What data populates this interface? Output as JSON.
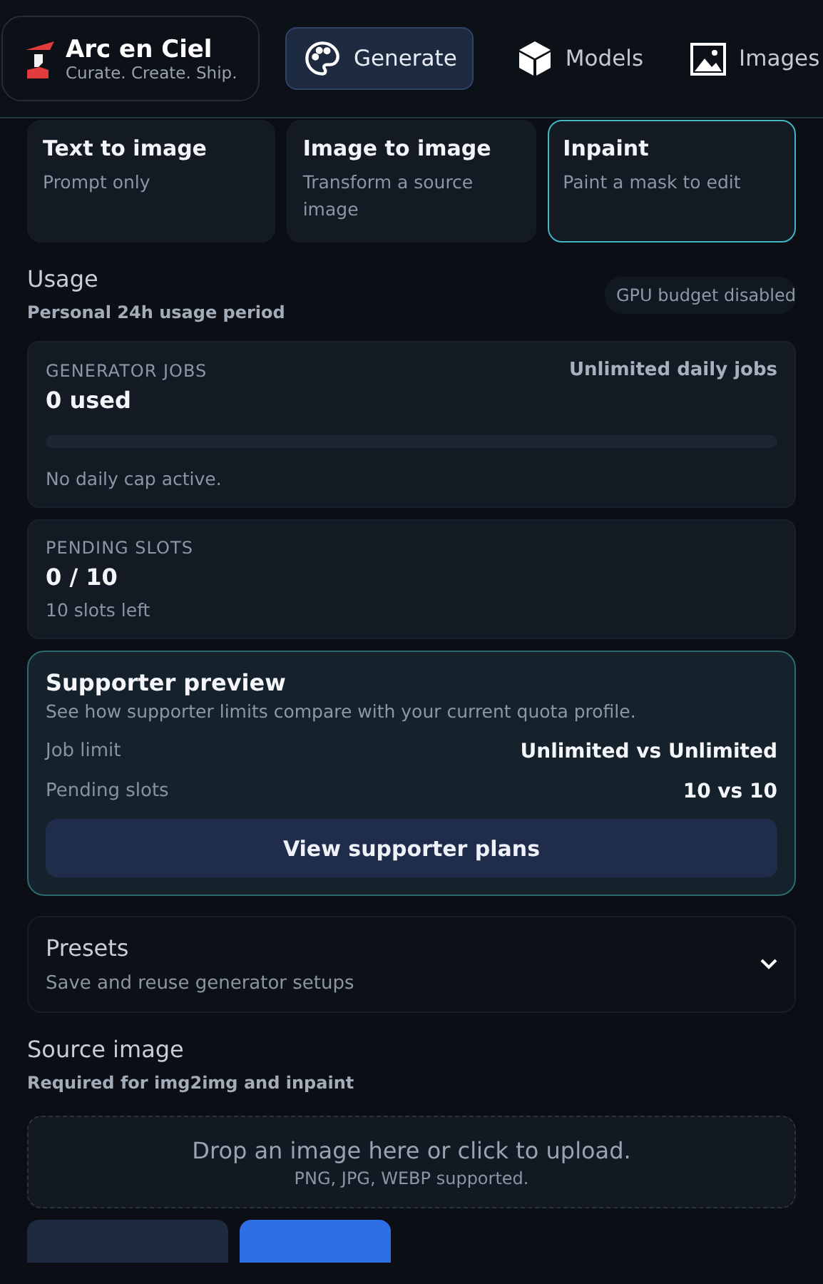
{
  "brand": {
    "name": "Arc en Ciel",
    "tagline": "Curate. Create. Ship."
  },
  "nav": [
    {
      "label": "Generate",
      "selected": true
    },
    {
      "label": "Models",
      "selected": false
    },
    {
      "label": "Images",
      "selected": false
    }
  ],
  "modes": [
    {
      "title": "Text to image",
      "description": "Prompt only",
      "selected": false
    },
    {
      "title": "Image to image",
      "description": "Transform a source image",
      "selected": false
    },
    {
      "title": "Inpaint",
      "description": "Paint a mask to edit",
      "selected": true
    }
  ],
  "usage": {
    "title": "Usage",
    "subtitle": "Personal 24h usage period",
    "badge": "GPU budget disabled",
    "jobs": {
      "label": "GENERATOR JOBS",
      "value": "0 used",
      "limit": "Unlimited daily jobs",
      "note": "No daily cap active."
    },
    "slots": {
      "label": "PENDING SLOTS",
      "value": "0 / 10",
      "note": "10 slots left"
    }
  },
  "supporter": {
    "title": "Supporter preview",
    "description": "See how supporter limits compare with your current quota profile.",
    "rows": [
      {
        "label": "Job limit",
        "value": "Unlimited vs Unlimited"
      },
      {
        "label": "Pending slots",
        "value": "10 vs 10"
      }
    ],
    "button": "View supporter plans"
  },
  "presets": {
    "title": "Presets",
    "subtitle": "Save and reuse generator setups",
    "expanded": false
  },
  "source": {
    "title": "Source image",
    "subtitle": "Required for img2img and inpaint",
    "drop": "Drop an image here or click to upload.",
    "formats": "PNG, JPG, WEBP supported."
  },
  "bottom_buttons": [
    {
      "kind": "secondary"
    },
    {
      "kind": "primary"
    }
  ]
}
